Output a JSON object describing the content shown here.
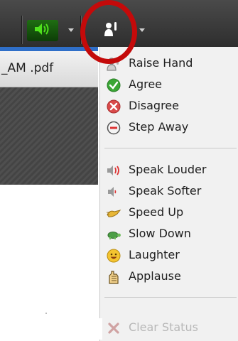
{
  "document": {
    "tab_title": "_AM .pdf"
  },
  "toolbar": {
    "speaker_icon": "speaker-icon",
    "status_icon": "raise-hand-status-icon"
  },
  "status_menu": {
    "groups": [
      [
        {
          "label": "Raise Hand",
          "icon": "raise-hand-icon"
        },
        {
          "label": "Agree",
          "icon": "agree-icon"
        },
        {
          "label": "Disagree",
          "icon": "disagree-icon"
        },
        {
          "label": "Step Away",
          "icon": "step-away-icon"
        }
      ],
      [
        {
          "label": "Speak Louder",
          "icon": "speak-louder-icon"
        },
        {
          "label": "Speak Softer",
          "icon": "speak-softer-icon"
        },
        {
          "label": "Speed Up",
          "icon": "speed-up-icon"
        },
        {
          "label": "Slow Down",
          "icon": "slow-down-icon"
        },
        {
          "label": "Laughter",
          "icon": "laughter-icon"
        },
        {
          "label": "Applause",
          "icon": "applause-icon"
        }
      ],
      [
        {
          "label": "Clear Status",
          "icon": "clear-status-icon",
          "disabled": true
        }
      ]
    ]
  },
  "colors": {
    "annotation_circle": "#c40a0a",
    "speaker_button": "#3cbf1a",
    "agree": "#3aa635",
    "disagree": "#d94a4a"
  }
}
